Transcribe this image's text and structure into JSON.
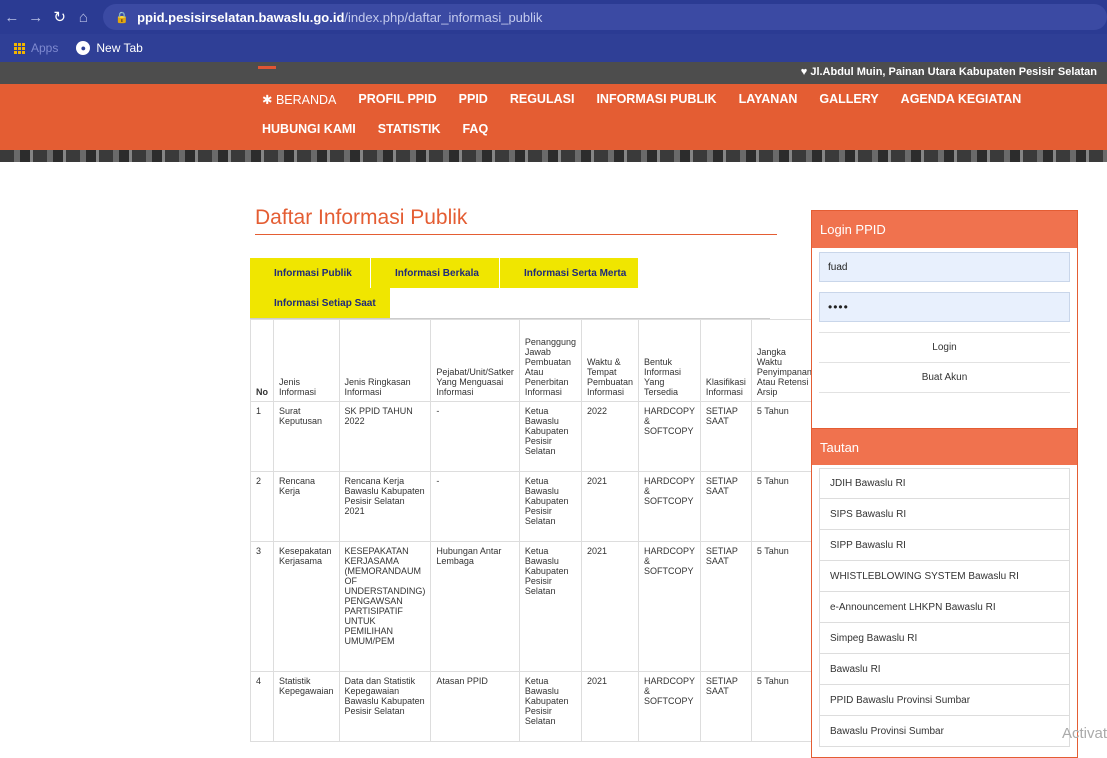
{
  "browser": {
    "url_host": "ppid.pesisirselatan.bawaslu.go.id",
    "url_path": "/index.php/daftar_informasi_publik",
    "bookmarks": {
      "apps_label": "Apps",
      "new_tab": "New Tab"
    }
  },
  "header": {
    "address": "♥ Jl.Abdul Muin, Painan Utara Kabupaten Pesisir Selatan",
    "nav_row1": [
      "BERANDA",
      "PROFIL PPID",
      "PPID",
      "REGULASI",
      "INFORMASI PUBLIK",
      "LAYANAN",
      "GALLERY",
      "AGENDA KEGIATAN"
    ],
    "nav_row2": [
      "HUBUNGI KAMI",
      "STATISTIK",
      "FAQ"
    ]
  },
  "main": {
    "title": "Daftar Informasi Publik",
    "tabs": [
      "Informasi Publik",
      "Informasi Berkala",
      "Informasi Serta Merta",
      "Informasi Setiap Saat"
    ],
    "table": {
      "headers": [
        "No",
        "Jenis Informasi",
        "Jenis Ringkasan Informasi",
        "Pejabat/Unit/Satker Yang Menguasai Informasi",
        "Penanggung Jawab Pembuatan Atau Penerbitan Informasi",
        "Waktu & Tempat Pembuatan Informasi",
        "Bentuk Informasi Yang Tersedia",
        "Klasifikasi Informasi",
        "Jangka Waktu Penyimpanan Atau Retensi Arsip"
      ],
      "rows": [
        [
          "1",
          "Surat Keputusan",
          "SK PPID TAHUN 2022",
          "-",
          "Ketua Bawaslu Kabupaten Pesisir Selatan",
          "2022",
          "HARDCOPY & SOFTCOPY",
          "SETIAP SAAT",
          "5 Tahun"
        ],
        [
          "2",
          "Rencana Kerja",
          "Rencana Kerja Bawaslu Kabupaten Pesisir Selatan 2021",
          "-",
          "Ketua Bawaslu Kabupaten Pesisir Selatan",
          "2021",
          "HARDCOPY & SOFTCOPY",
          "SETIAP SAAT",
          "5 Tahun"
        ],
        [
          "3",
          "Kesepakatan Kerjasama",
          "KESEPAKATAN KERJASAMA (MEMORANDAUM OF UNDERSTANDING) PENGAWSAN PARTISIPATIF UNTUK PEMILIHAN UMUM/PEM",
          "Hubungan Antar Lembaga",
          "Ketua Bawaslu Kabupaten Pesisir Selatan",
          "2021",
          "HARDCOPY & SOFTCOPY",
          "SETIAP SAAT",
          "5 Tahun"
        ],
        [
          "4",
          "Statistik Kepegawaian",
          "Data dan Statistik Kepegawaian Bawaslu Kabupaten Pesisir Selatan",
          "Atasan PPID",
          "Ketua Bawaslu Kabupaten Pesisir Selatan",
          "2021",
          "HARDCOPY & SOFTCOPY",
          "SETIAP SAAT",
          "5 Tahun"
        ]
      ]
    }
  },
  "sidebar": {
    "login": {
      "title": "Login PPID",
      "username_value": "fuad",
      "password_value": "••••",
      "login_label": "Login",
      "register_label": "Buat Akun"
    },
    "tautan": {
      "title": "Tautan",
      "links": [
        "JDIH Bawaslu RI",
        "SIPS Bawaslu RI",
        "SIPP Bawaslu RI",
        "WHISTLEBLOWING SYSTEM Bawaslu RI",
        "e-Announcement LHKPN Bawaslu RI",
        "Simpeg Bawaslu RI",
        "Bawaslu RI",
        "PPID Bawaslu Provinsi Sumbar",
        "Bawaslu Provinsi Sumbar"
      ]
    }
  },
  "watermark": "Activat"
}
